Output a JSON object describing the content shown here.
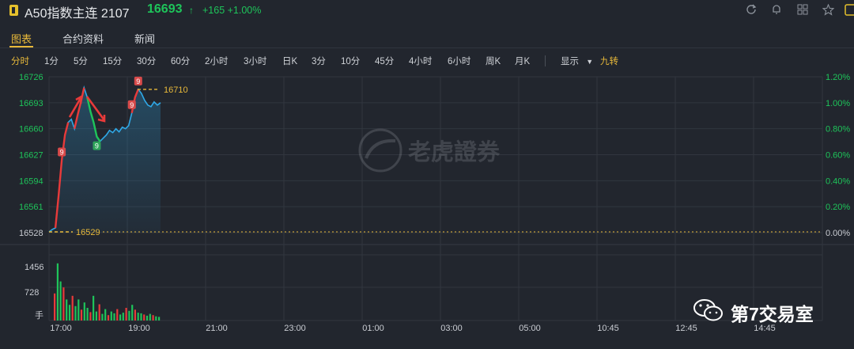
{
  "header": {
    "title": "A50指数主连 2107",
    "price": "16693",
    "arrow": "↑",
    "change": "+165 +1.00%",
    "icons": [
      "refresh-icon",
      "bell-icon",
      "grid-icon",
      "star-icon",
      "panel-icon"
    ]
  },
  "tabs": [
    {
      "label": "图表",
      "active": true
    },
    {
      "label": "合约资料",
      "active": false
    },
    {
      "label": "新闻",
      "active": false
    }
  ],
  "periods": [
    {
      "label": "分时",
      "active": true
    },
    {
      "label": "1分"
    },
    {
      "label": "5分"
    },
    {
      "label": "15分"
    },
    {
      "label": "30分"
    },
    {
      "label": "60分"
    },
    {
      "label": "2小时"
    },
    {
      "label": "3小时"
    },
    {
      "label": "日K"
    },
    {
      "label": "3分"
    },
    {
      "label": "10分"
    },
    {
      "label": "45分"
    },
    {
      "label": "4小时"
    },
    {
      "label": "6小时"
    },
    {
      "label": "周K"
    },
    {
      "label": "月K"
    }
  ],
  "display_label": "显示",
  "nine_turn_label": "九转",
  "colors": {
    "up": "#1ec45a",
    "down": "#e83a3a",
    "accent": "#e8b93a",
    "line": "#2fa9e8"
  },
  "chart_data": {
    "type": "line",
    "y_labels_left": [
      "16726",
      "16693",
      "16660",
      "16627",
      "16594",
      "16561",
      "16528"
    ],
    "y_labels_right": [
      "1.20%",
      "1.00%",
      "0.80%",
      "0.60%",
      "0.40%",
      "0.20%",
      "0.00%"
    ],
    "ylim": [
      16528,
      16726
    ],
    "x_labels": [
      "17:00",
      "19:00",
      "21:00",
      "23:00",
      "01:00",
      "03:00",
      "05:00",
      "10:45",
      "12:45",
      "14:45"
    ],
    "high_marker": "16710",
    "base_marker": "16529",
    "price_series": [
      16529,
      16532,
      16534,
      16575,
      16620,
      16652,
      16668,
      16672,
      16660,
      16678,
      16694,
      16712,
      16700,
      16682,
      16668,
      16650,
      16644,
      16648,
      16652,
      16658,
      16655,
      16660,
      16656,
      16662,
      16660,
      16664,
      16680,
      16700,
      16710,
      16705,
      16696,
      16690,
      16688,
      16694,
      16690,
      16693
    ],
    "volume_labels": [
      "1456",
      "728",
      "手"
    ],
    "volume_max": 2184,
    "volume_series": [
      900,
      1900,
      1300,
      1100,
      700,
      520,
      820,
      480,
      700,
      360,
      600,
      420,
      280,
      820,
      300,
      540,
      220,
      380,
      180,
      300,
      240,
      380,
      200,
      260,
      420,
      320,
      520,
      360,
      260,
      240,
      200,
      160,
      220,
      180,
      140,
      120
    ],
    "td_markers": [
      {
        "label": "9",
        "type": "up"
      },
      {
        "label": "9",
        "type": "down"
      },
      {
        "label": "9",
        "type": "up"
      },
      {
        "label": "9",
        "type": "up"
      }
    ]
  },
  "watermark": "老虎證券",
  "wechat_label": "第7交易室"
}
